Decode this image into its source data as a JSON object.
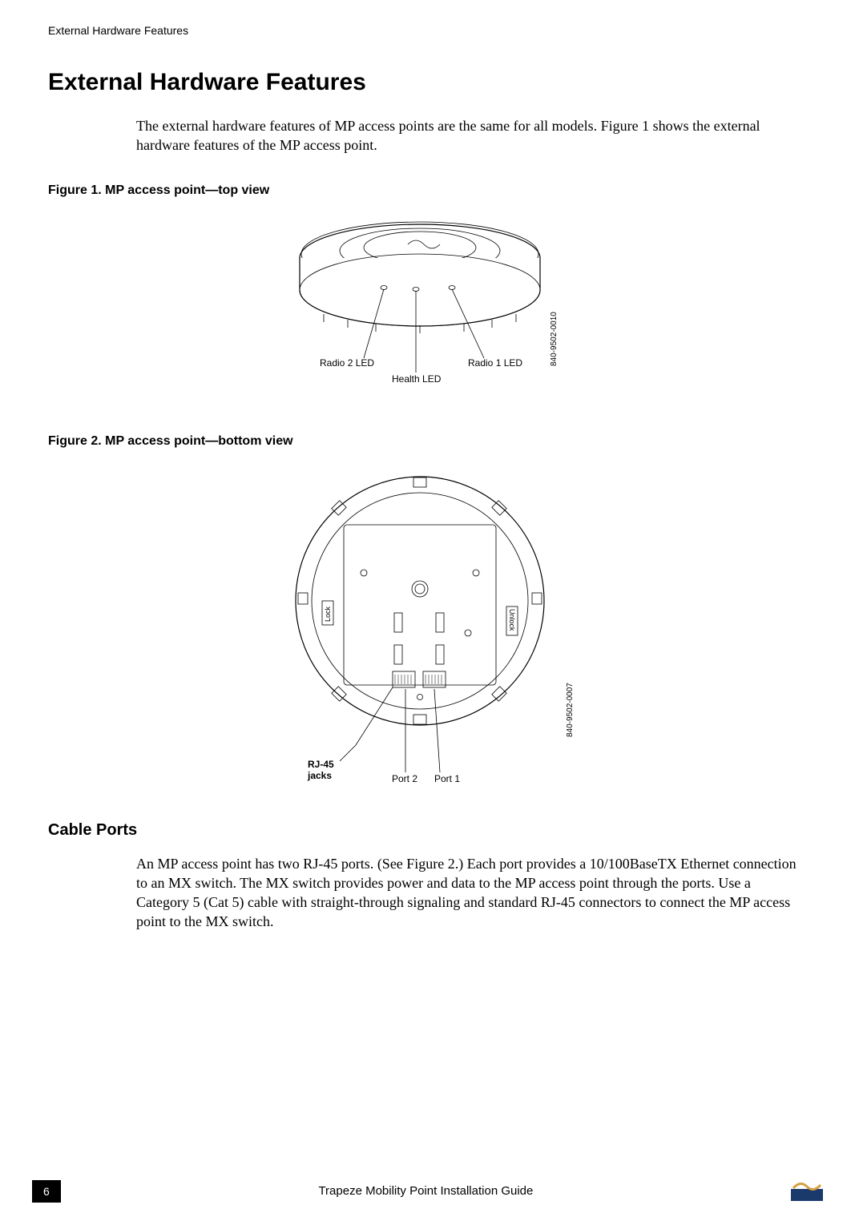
{
  "running_header": "External Hardware Features",
  "h1": "External Hardware Features",
  "intro": "The external hardware features of MP access points are the same for all models.  Figure 1 shows the external hardware features of the MP access point.",
  "figure1": {
    "label": "Figure 1.    MP access point—top view",
    "callouts": {
      "radio2": "Radio 2 LED",
      "health": "Health LED",
      "radio1": "Radio 1 LED"
    },
    "partno": "840-9502-0010"
  },
  "figure2": {
    "label": "Figure 2.    MP access point—bottom view",
    "callouts": {
      "rj45_line1": "RJ-45",
      "rj45_line2": "jacks",
      "port2": "Port 2",
      "port1": "Port 1",
      "lock": "Lock",
      "unlock": "Unlock"
    },
    "partno": "840-9502-0007"
  },
  "h2_cable_ports": "Cable Ports",
  "cable_ports_para": "An MP access point has two RJ-45 ports. (See Figure 2.) Each port provides a 10/100BaseTX Ethernet connection to an MX switch.  The MX switch provides power and data to the MP access point through the ports. Use a Category 5 (Cat 5) cable with straight-through signaling and standard RJ-45 connectors to connect the MP access point to the MX switch.",
  "footer": {
    "page": "6",
    "title": "Trapeze Mobility Point Installation Guide"
  }
}
